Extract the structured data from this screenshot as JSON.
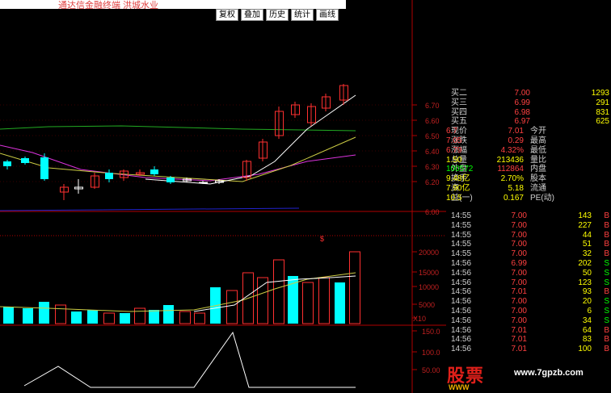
{
  "window": {
    "title": "通达信金融终端  洪城水业"
  },
  "toolbar": {
    "buttons": [
      "复权",
      "叠加",
      "历史",
      "统计",
      "画线"
    ]
  },
  "price_axis": [
    "6.70",
    "6.60",
    "6.50",
    "6.40",
    "6.30",
    "6.20",
    "6.00"
  ],
  "volume_axis": [
    "20000",
    "15000",
    "10000",
    "5000",
    "X10"
  ],
  "indicator_axis": [
    "150.0",
    "100.0",
    "50.00"
  ],
  "marker": "$",
  "quote": [
    {
      "label": "买二",
      "val": "7.00",
      "extra": "1293",
      "valColor": "#ff4040",
      "extraColor": "#ffff00"
    },
    {
      "label": "买三",
      "val": "6.99",
      "extra": "291",
      "valColor": "#ff4040",
      "extraColor": "#ffff00"
    },
    {
      "label": "买四",
      "val": "6.98",
      "extra": "831",
      "valColor": "#ff4040",
      "extraColor": "#ffff00"
    },
    {
      "label": "买五",
      "val": "6.97",
      "extra": "625",
      "valColor": "#ff4040",
      "extraColor": "#ffff00"
    },
    {
      "label": "现价",
      "val": "7.01",
      "label2": "今开",
      "val2": "6.7",
      "valColor": "#ff4040",
      "extraColor": "#ff4040"
    },
    {
      "label": "涨跌",
      "val": "0.29",
      "label2": "最高",
      "val2": "7.05",
      "valColor": "#ff4040",
      "extraColor": "#ff4040"
    },
    {
      "label": "涨幅",
      "val": "4.32%",
      "label2": "最低",
      "val2": "6.79",
      "valColor": "#ff4040",
      "extraColor": "#ff4040"
    },
    {
      "label": "总量",
      "val": "213436",
      "label2": "量比",
      "val2": "1.50",
      "valColor": "#ffff00",
      "extraColor": "#ffff00"
    },
    {
      "label": "外盘",
      "val": "112864",
      "label2": "内盘",
      "val2": "100572",
      "valColor": "#ff4040",
      "extraColor": "#00ff00"
    },
    {
      "label": "换手",
      "val": "2.70%",
      "label2": "股本",
      "val2": "9.48亿",
      "valColor": "#ffff00",
      "extraColor": "#ffff00"
    },
    {
      "label": "资",
      "val": "5.18",
      "label2": "流通",
      "val2": "7.90亿",
      "valColor": "#ffff00",
      "extraColor": "#ffff00"
    },
    {
      "label": "益(一)",
      "val": "0.167",
      "label2": "PE(动)",
      "val2": "10.5",
      "valColor": "#ffff00",
      "extraColor": "#ffff00"
    }
  ],
  "trades": [
    {
      "time": "14:55",
      "price": "7.00",
      "vol": "143",
      "side": "B"
    },
    {
      "time": "14:55",
      "price": "7.00",
      "vol": "227",
      "side": "B"
    },
    {
      "time": "14:55",
      "price": "7.00",
      "vol": "44",
      "side": "B"
    },
    {
      "time": "14:55",
      "price": "7.00",
      "vol": "51",
      "side": "B"
    },
    {
      "time": "14:55",
      "price": "7.00",
      "vol": "32",
      "side": "B"
    },
    {
      "time": "14:56",
      "price": "6.99",
      "vol": "202",
      "side": "S"
    },
    {
      "time": "14:56",
      "price": "7.00",
      "vol": "50",
      "side": "S"
    },
    {
      "time": "14:56",
      "price": "7.00",
      "vol": "123",
      "side": "S"
    },
    {
      "time": "14:56",
      "price": "7.01",
      "vol": "93",
      "side": "B"
    },
    {
      "time": "14:56",
      "price": "7.00",
      "vol": "20",
      "side": "S"
    },
    {
      "time": "14:56",
      "price": "7.00",
      "vol": "6",
      "side": "S"
    },
    {
      "time": "14:56",
      "price": "7.00",
      "vol": "34",
      "side": "S"
    },
    {
      "time": "14:56",
      "price": "7.01",
      "vol": "64",
      "side": "B"
    },
    {
      "time": "14:56",
      "price": "7.01",
      "vol": "83",
      "side": "B"
    },
    {
      "time": "14:56",
      "price": "7.01",
      "vol": "100",
      "side": "B"
    }
  ],
  "logo": {
    "big": "股票",
    "small": "WWW"
  },
  "site": "www.7gpzb.com",
  "colors": {
    "up": "#ff3030",
    "down": "#00ffff",
    "grid": "#a00000",
    "axis": "#b00000"
  }
}
